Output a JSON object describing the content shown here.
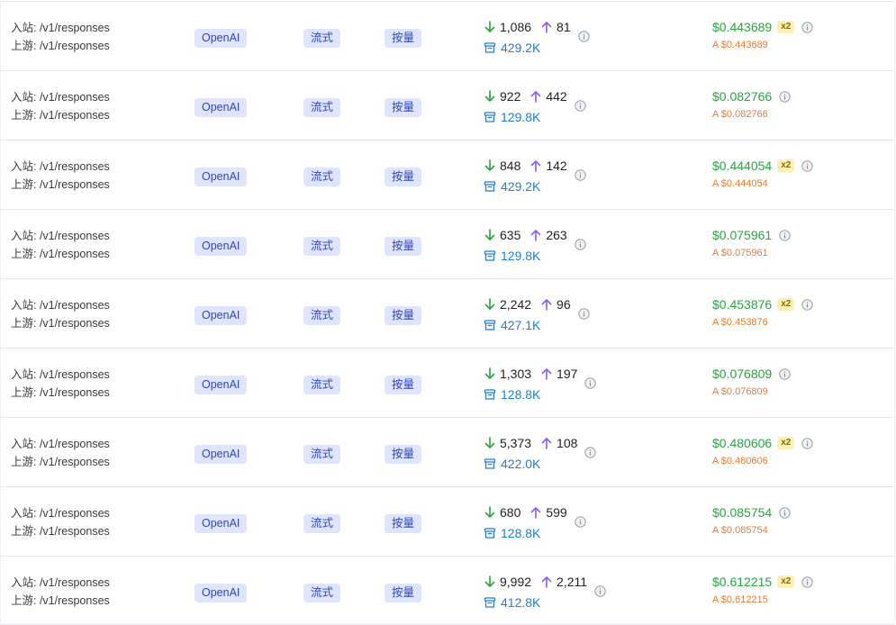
{
  "colors": {
    "tag_bg": "#dfe5ff",
    "tag_text": "#2f47b8",
    "arrow_down": "#27a53e",
    "arrow_up": "#8b5cf6",
    "cache": "#1f7fd1",
    "price": "#27a53e",
    "subprice": "#f07a28",
    "multiplier_bg": "#fff0b3"
  },
  "icons": {
    "input_tokens": "arrow-down-icon",
    "output_tokens": "arrow-up-icon",
    "cache": "archive-box-icon",
    "info": "info-circle-icon"
  },
  "rows": [
    {
      "inbound": "入站: /v1/responses",
      "upstream": "上游: /v1/responses",
      "provider": "OpenAI",
      "mode": "流式",
      "billing": "按量",
      "input_tokens": "1,086",
      "output_tokens": "81",
      "cache": "429.2K",
      "price": "$0.443689",
      "multiplier": "x2",
      "sub_price": "A $0.443689"
    },
    {
      "inbound": "入站: /v1/responses",
      "upstream": "上游: /v1/responses",
      "provider": "OpenAI",
      "mode": "流式",
      "billing": "按量",
      "input_tokens": "922",
      "output_tokens": "442",
      "cache": "129.8K",
      "price": "$0.082766",
      "multiplier": "",
      "sub_price": "A $0.082766"
    },
    {
      "inbound": "入站: /v1/responses",
      "upstream": "上游: /v1/responses",
      "provider": "OpenAI",
      "mode": "流式",
      "billing": "按量",
      "input_tokens": "848",
      "output_tokens": "142",
      "cache": "429.2K",
      "price": "$0.444054",
      "multiplier": "x2",
      "sub_price": "A $0.444054"
    },
    {
      "inbound": "入站: /v1/responses",
      "upstream": "上游: /v1/responses",
      "provider": "OpenAI",
      "mode": "流式",
      "billing": "按量",
      "input_tokens": "635",
      "output_tokens": "263",
      "cache": "129.8K",
      "price": "$0.075961",
      "multiplier": "",
      "sub_price": "A $0.075961"
    },
    {
      "inbound": "入站: /v1/responses",
      "upstream": "上游: /v1/responses",
      "provider": "OpenAI",
      "mode": "流式",
      "billing": "按量",
      "input_tokens": "2,242",
      "output_tokens": "96",
      "cache": "427.1K",
      "price": "$0.453876",
      "multiplier": "x2",
      "sub_price": "A $0.453876"
    },
    {
      "inbound": "入站: /v1/responses",
      "upstream": "上游: /v1/responses",
      "provider": "OpenAI",
      "mode": "流式",
      "billing": "按量",
      "input_tokens": "1,303",
      "output_tokens": "197",
      "cache": "128.8K",
      "price": "$0.076809",
      "multiplier": "",
      "sub_price": "A $0.076809"
    },
    {
      "inbound": "入站: /v1/responses",
      "upstream": "上游: /v1/responses",
      "provider": "OpenAI",
      "mode": "流式",
      "billing": "按量",
      "input_tokens": "5,373",
      "output_tokens": "108",
      "cache": "422.0K",
      "price": "$0.480606",
      "multiplier": "x2",
      "sub_price": "A $0.480606"
    },
    {
      "inbound": "入站: /v1/responses",
      "upstream": "上游: /v1/responses",
      "provider": "OpenAI",
      "mode": "流式",
      "billing": "按量",
      "input_tokens": "680",
      "output_tokens": "599",
      "cache": "128.8K",
      "price": "$0.085754",
      "multiplier": "",
      "sub_price": "A $0.085754"
    },
    {
      "inbound": "入站: /v1/responses",
      "upstream": "上游: /v1/responses",
      "provider": "OpenAI",
      "mode": "流式",
      "billing": "按量",
      "input_tokens": "9,992",
      "output_tokens": "2,211",
      "cache": "412.8K",
      "price": "$0.612215",
      "multiplier": "x2",
      "sub_price": "A $0.612215"
    }
  ]
}
